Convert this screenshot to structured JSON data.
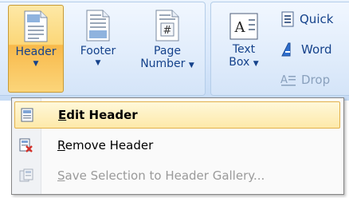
{
  "ribbon": {
    "header_btn": {
      "label": "Header"
    },
    "footer_btn": {
      "label": "Footer"
    },
    "page_number_btn": {
      "label_line1": "Page",
      "label_line2": "Number"
    },
    "text_box_btn": {
      "label_line1": "Text",
      "label_line2": "Box"
    },
    "quick_label": "Quick",
    "word_label": "Word",
    "drop_label": "Drop"
  },
  "menu": {
    "items": [
      {
        "mnemonic": "E",
        "rest": "dit Header",
        "enabled": true,
        "highlighted": true,
        "icon": "edit-header-icon"
      },
      {
        "mnemonic": "R",
        "rest": "emove Header",
        "enabled": true,
        "highlighted": false,
        "icon": "remove-header-icon"
      },
      {
        "mnemonic": "S",
        "rest": "ave Selection to Header Gallery...",
        "enabled": false,
        "highlighted": false,
        "icon": "save-selection-icon"
      }
    ]
  },
  "colors": {
    "accent": "#fcd778",
    "text": "#15428b",
    "border": "#868686"
  }
}
